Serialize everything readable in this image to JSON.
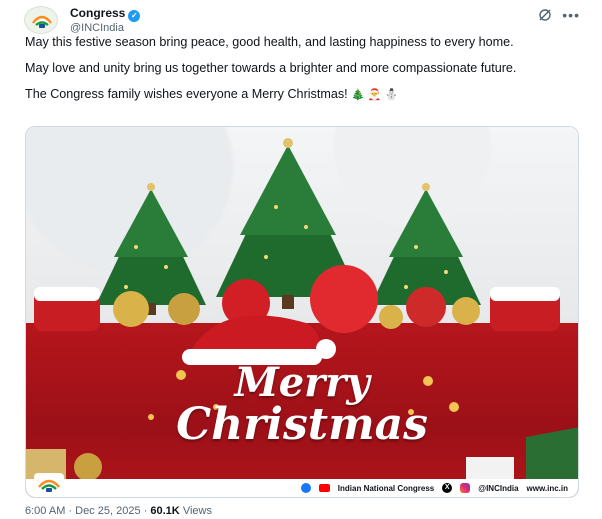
{
  "author": {
    "display_name": "Congress",
    "handle": "@INCIndia",
    "verified_glyph": "✓"
  },
  "tweet": {
    "paragraphs": [
      "May this festive season bring peace, good health, and lasting happiness to every home.",
      "May love and unity bring us together towards a brighter and more compassionate future.",
      "The Congress family wishes everyone a Merry Christmas!"
    ],
    "emojis": "🎄 🎅 ⛄"
  },
  "media": {
    "greeting_line1": "Merry",
    "greeting_line2": "Christmas",
    "footer_name": "Indian National Congress",
    "footer_handle": "@INCIndia",
    "footer_site": "www.inc.in",
    "x_glyph": "X"
  },
  "meta": {
    "time": "6:00 AM",
    "separator": "·",
    "date": "Dec 25, 2025",
    "views_count": "60.1K",
    "views_label": "Views"
  },
  "icons": {
    "more": "more-icon",
    "grok": "grok-icon",
    "verified": "verified-badge-icon"
  },
  "colors": {
    "verified_blue": "#1d9bf0",
    "text_primary": "#0f1419",
    "text_secondary": "#536471",
    "banner_red": "#b5161c"
  }
}
